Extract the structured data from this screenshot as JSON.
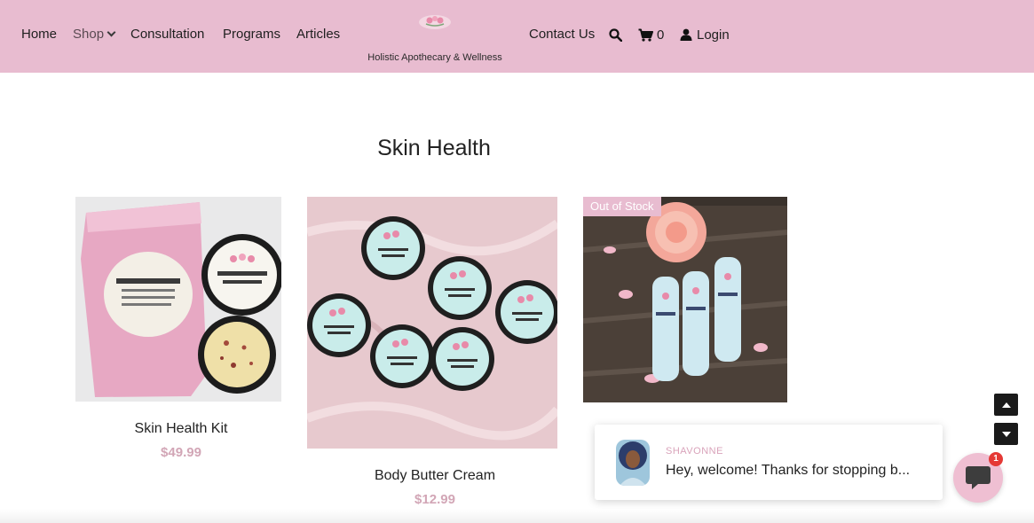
{
  "nav": {
    "home": "Home",
    "shop": "Shop",
    "consultation": "Consultation",
    "programs": "Programs",
    "articles": "Articles",
    "tagline": "Holistic Apothecary & Wellness",
    "contact": "Contact Us",
    "cart_count": "0",
    "login": "Login",
    "icons": [
      "search-icon",
      "cart-icon",
      "user-icon",
      "chevron-down-icon"
    ]
  },
  "page": {
    "title": "Skin Health"
  },
  "products": [
    {
      "name": "Skin Health Kit",
      "price": "$49.99"
    },
    {
      "name": "Body Butter Cream",
      "price": "$12.99"
    },
    {
      "badge": "Out of Stock"
    }
  ],
  "chat": {
    "agent": "SHAVONNE",
    "message": "Hey, welcome! Thanks for stopping b...",
    "unread": "1"
  },
  "colors": {
    "header_bg": "#e8bcd0",
    "price": "#d2a6b6",
    "chat_bubble": "#efbfd2",
    "badge_red": "#e53935"
  }
}
